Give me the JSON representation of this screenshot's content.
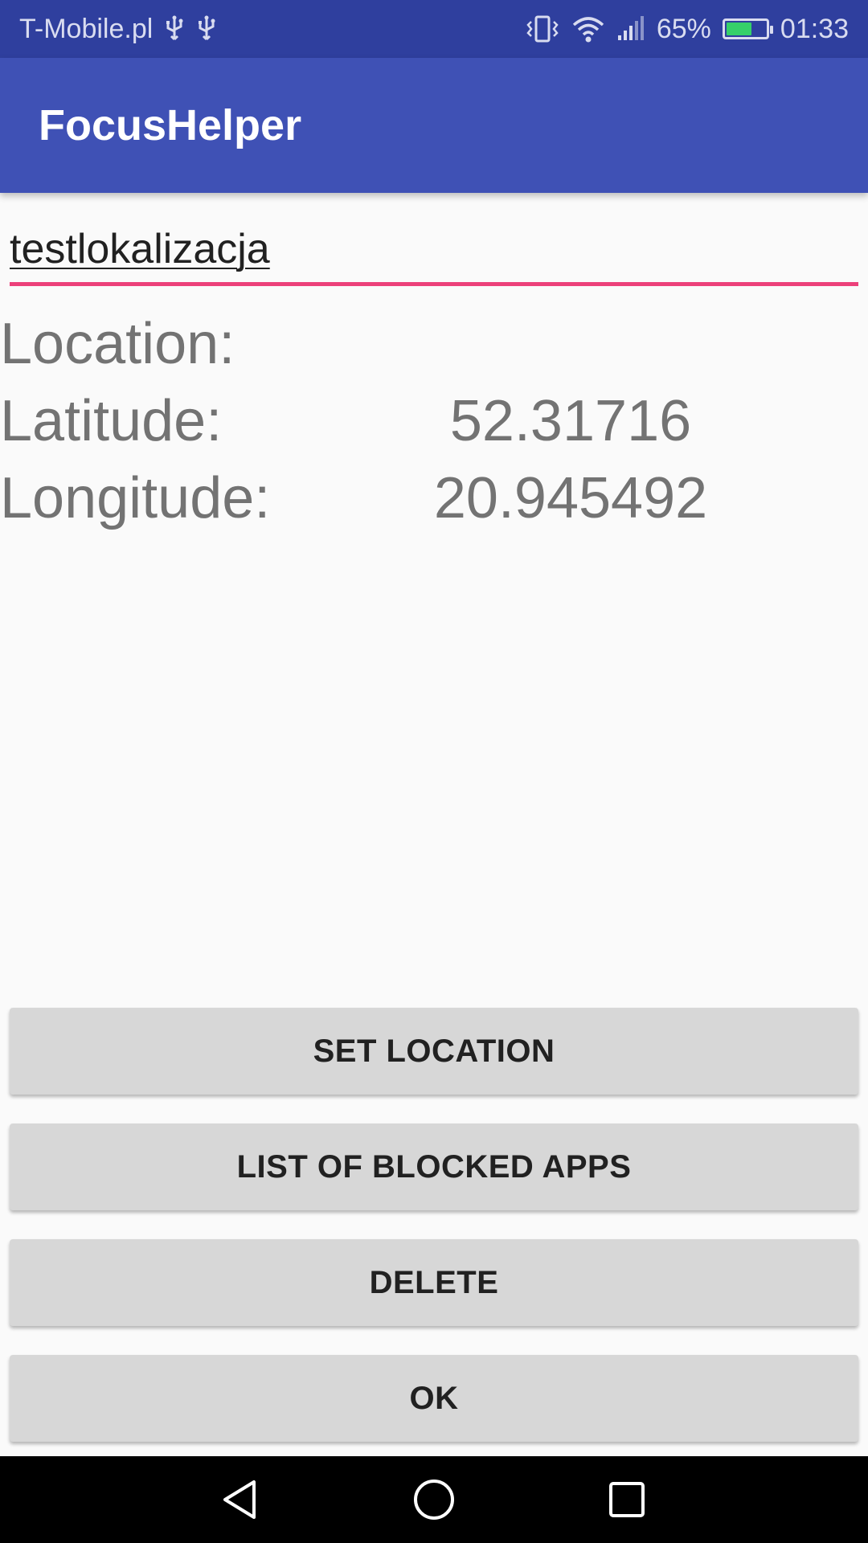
{
  "status_bar": {
    "carrier": "T-Mobile.pl",
    "battery_percent": "65%",
    "battery_level": 0.65,
    "time": "01:33",
    "icons": [
      "usb-icon",
      "usb-icon",
      "vibrate-icon",
      "wifi-icon",
      "signal-icon",
      "battery-charging-icon"
    ]
  },
  "app_bar": {
    "title": "FocusHelper"
  },
  "name_field": {
    "value": "testlokalizacja"
  },
  "location": {
    "header": "Location:",
    "latitude_label": "Latitude:",
    "latitude_value": "52.31716",
    "longitude_label": "Longitude:",
    "longitude_value": "20.945492"
  },
  "buttons": {
    "set_location": "SET LOCATION",
    "blocked_apps": "LIST OF BLOCKED APPS",
    "delete": "DELETE",
    "ok": "OK"
  },
  "nav_bar": {
    "icons": [
      "back-icon",
      "home-icon",
      "recents-icon"
    ]
  },
  "colors": {
    "status_bar": "#2f3f9e",
    "app_bar": "#3f51b5",
    "input_underline": "#ec407a",
    "button_bg": "#d7d7d7"
  }
}
